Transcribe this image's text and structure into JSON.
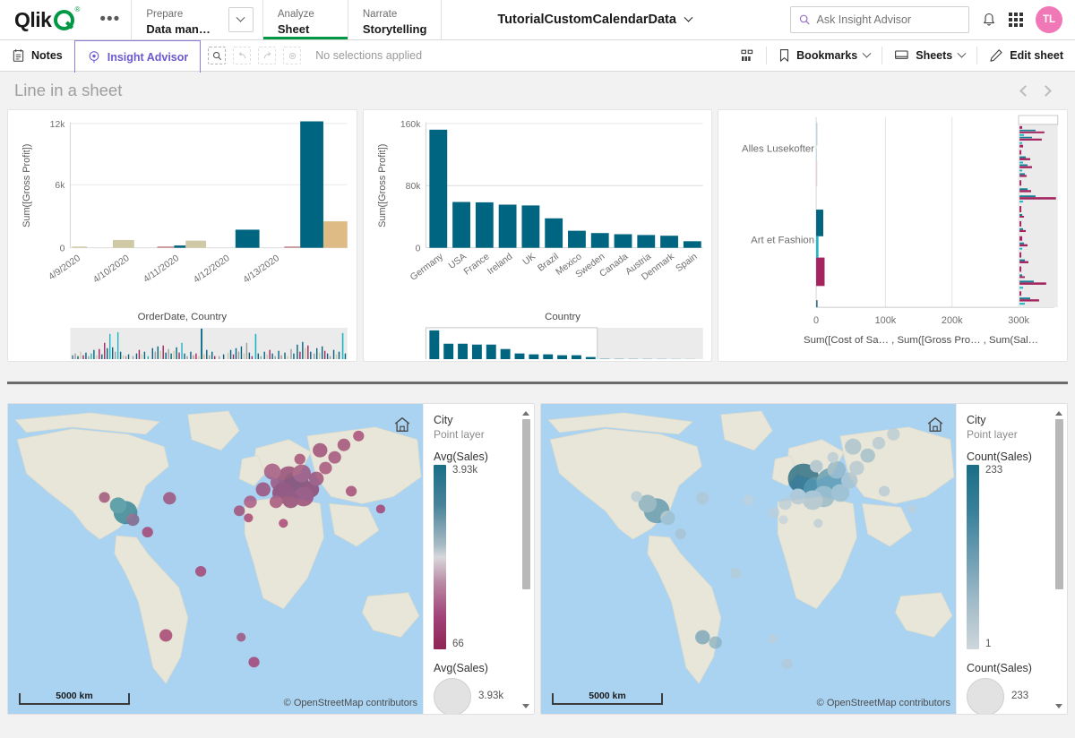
{
  "header": {
    "logo_text": "Qlik",
    "ellipsis": "•••",
    "nav": [
      {
        "sup": "Prepare",
        "main": "Data man…",
        "active": false
      },
      {
        "sup": "Analyze",
        "main": "Sheet",
        "active": true
      },
      {
        "sup": "Narrate",
        "main": "Storytelling",
        "active": false
      }
    ],
    "app_title": "TutorialCustomCalendarData",
    "search_placeholder": "Ask Insight Advisor",
    "avatar_initials": "TL"
  },
  "toolbar": {
    "notes_label": "Notes",
    "insight_advisor_label": "Insight Advisor",
    "selection_status": "No selections applied",
    "bookmarks_label": "Bookmarks",
    "sheets_label": "Sheets",
    "edit_sheet_label": "Edit sheet"
  },
  "sheet": {
    "title": "Line in a sheet"
  },
  "colors": {
    "teal": "#006580",
    "tan": "#DEBA84",
    "khaki": "#CFC9A5",
    "rose": "#C4868A",
    "cyan": "#1FB5C4",
    "magenta": "#A3245F",
    "pink_avatar": "#F178B6",
    "green_accent": "#009845",
    "purple_accent": "#6A5ACD"
  },
  "chart_data": [
    {
      "type": "bar",
      "title": "",
      "xlabel": "OrderDate, Country",
      "ylabel": "Sum([Gross Profit])",
      "ylim": [
        0,
        13000
      ],
      "yticks": [
        0,
        6000,
        12000
      ],
      "ytick_labels": [
        "0",
        "6k",
        "12k"
      ],
      "categories": [
        "4/9/2020",
        "4/10/2020",
        "4/11/2020",
        "4/12/2020",
        "4/13/2020"
      ],
      "grid": true,
      "bars": [
        {
          "group": "4/9/2020",
          "value": 120,
          "color": "#CFC9A5"
        },
        {
          "group": "4/10/2020",
          "value": 750,
          "color": "#CFC9A5"
        },
        {
          "group": "4/11/2020",
          "value": 130,
          "color": "#C4868A"
        },
        {
          "group": "4/11/2020",
          "value": 220,
          "color": "#006580"
        },
        {
          "group": "4/11/2020",
          "value": 690,
          "color": "#CFC9A5"
        },
        {
          "group": "4/12/2020",
          "value": 1750,
          "color": "#006580"
        },
        {
          "group": "4/13/2020",
          "value": 130,
          "color": "#C4868A"
        },
        {
          "group": "4/13/2020",
          "value": 12200,
          "color": "#006580"
        },
        {
          "group": "4/13/2020",
          "value": 2550,
          "color": "#DEBA84"
        }
      ],
      "scrollbar": {
        "visible": true,
        "window_start": 0.0,
        "window_end": 1.0
      }
    },
    {
      "type": "bar",
      "title": "",
      "xlabel": "Country",
      "ylabel": "Sum([Gross Profit])",
      "ylim": [
        0,
        165000
      ],
      "yticks": [
        0,
        80000,
        160000
      ],
      "ytick_labels": [
        "0",
        "80k",
        "160k"
      ],
      "categories": [
        "Germany",
        "USA",
        "France",
        "Ireland",
        "UK",
        "Brazil",
        "Mexico",
        "Sweden",
        "Canada",
        "Austria",
        "Denmark",
        "Spain"
      ],
      "values": [
        152000,
        59000,
        58500,
        55500,
        54500,
        38000,
        22000,
        19000,
        17500,
        16500,
        15500,
        8500
      ],
      "color": "#006580",
      "grid": true,
      "scrollbar": {
        "visible": true,
        "window_start": 0.0,
        "window_end": 0.62
      }
    },
    {
      "type": "bar",
      "orientation": "horizontal",
      "title": "",
      "xlabel": "Sum([Cost of Sa… , Sum([Gross Pro… , Sum(Sal…",
      "ylabel": "",
      "xlim": [
        0,
        340000
      ],
      "xticks": [
        0,
        100000,
        200000,
        300000
      ],
      "xtick_labels": [
        "0",
        "100k",
        "200k",
        "300k"
      ],
      "categories": [
        "Alles Lusekofter",
        "Art et Fashion"
      ],
      "series": [
        {
          "name": "Sum([Cost of Sales])",
          "color": "#006580"
        },
        {
          "name": "Sum([Gross Profit])",
          "color": "#1FB5C4"
        },
        {
          "name": "Sum(Sales)",
          "color": "#A3245F"
        }
      ],
      "visible_bars": [
        {
          "category": "Alles Lusekofter",
          "series": "Sum([Cost of Sales])",
          "value": 1500
        },
        {
          "category": "Alles Lusekofter",
          "series": "Sum([Gross Profit])",
          "value": 500
        },
        {
          "category": "Alles Lusekofter",
          "series": "Sum(Sales)",
          "value": 900
        },
        {
          "category": "Art et Fashion",
          "series": "Sum([Cost of Sales])",
          "value": 9500
        },
        {
          "category": "Art et Fashion",
          "series": "Sum([Gross Profit])",
          "value": 2200
        },
        {
          "category": "Art et Fashion",
          "series": "Sum(Sales)",
          "value": 11000
        }
      ],
      "grid": true,
      "scrollbar": {
        "visible": true,
        "orientation": "vertical"
      }
    }
  ],
  "maps": [
    {
      "id": "map-left",
      "layer_name": "City",
      "layer_type": "Point layer",
      "color_measure": "Avg(Sales)",
      "color_max": "3.93k",
      "color_min": "66",
      "ramp_top_color": "#1a6e87",
      "ramp_mid_color": "#d8d8dc",
      "ramp_bottom_color": "#8f2455",
      "size_measure": "Avg(Sales)",
      "size_max": "3.93k",
      "scale_label": "5000 km",
      "attribution": "© OpenStreetMap contributors"
    },
    {
      "id": "map-right",
      "layer_name": "City",
      "layer_type": "Point layer",
      "color_measure": "Count(Sales)",
      "color_max": "233",
      "color_min": "1",
      "ramp_top_color": "#1a6e87",
      "ramp_mid_color": "#8fb4c4",
      "ramp_bottom_color": "#cdd6db",
      "size_measure": "Count(Sales)",
      "size_max": "233",
      "scale_label": "5000 km",
      "attribution": "© OpenStreetMap contributors"
    }
  ]
}
